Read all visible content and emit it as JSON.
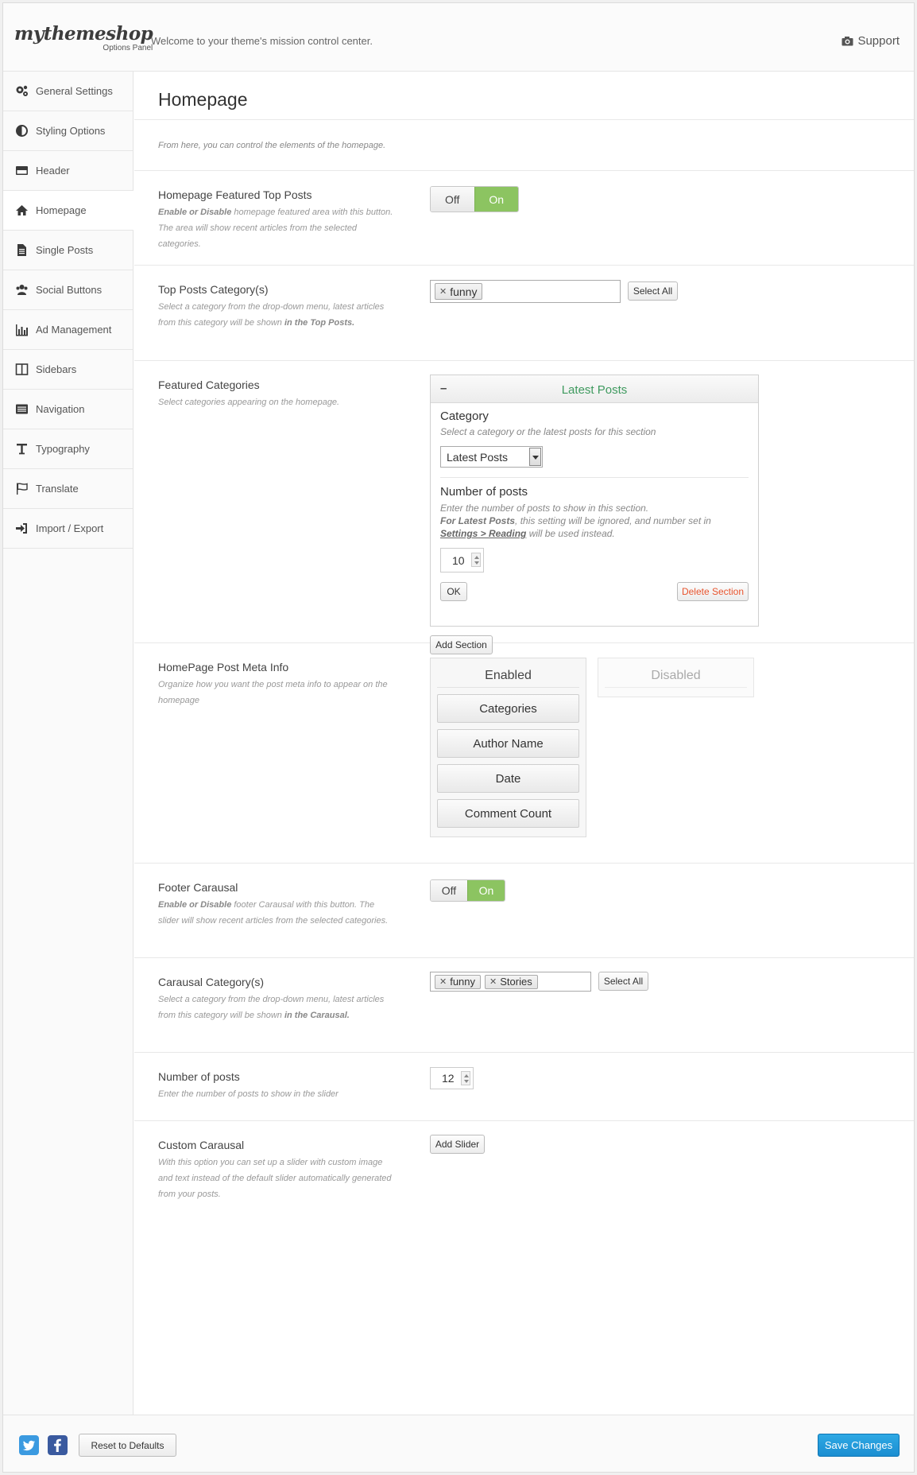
{
  "header": {
    "logo_main": "mythemeshop",
    "logo_sub": "Options Panel",
    "welcome": "Welcome to your theme's mission control center.",
    "support_label": "Support",
    "support_icon": "support-camera-icon"
  },
  "sidebar": {
    "items": [
      {
        "label": "General Settings",
        "icon": "gears-icon"
      },
      {
        "label": "Styling Options",
        "icon": "contrast-icon"
      },
      {
        "label": "Header",
        "icon": "credit-card-icon"
      },
      {
        "label": "Homepage",
        "icon": "home-icon",
        "active": true
      },
      {
        "label": "Single Posts",
        "icon": "document-icon"
      },
      {
        "label": "Social Buttons",
        "icon": "users-icon"
      },
      {
        "label": "Ad Management",
        "icon": "bar-chart-icon"
      },
      {
        "label": "Sidebars",
        "icon": "columns-icon"
      },
      {
        "label": "Navigation",
        "icon": "list-icon"
      },
      {
        "label": "Typography",
        "icon": "text-icon"
      },
      {
        "label": "Translate",
        "icon": "flag-icon"
      },
      {
        "label": "Import / Export",
        "icon": "import-icon"
      }
    ]
  },
  "main": {
    "title": "Homepage",
    "intro": "From here, you can control the elements of the homepage.",
    "featured_top": {
      "title": "Homepage Featured Top Posts",
      "desc_bold": "Enable or Disable",
      "desc_rest": " homepage featured area with this button. The area will show recent articles from the selected categories.",
      "off_label": "Off",
      "on_label": "On",
      "value": "On"
    },
    "top_category": {
      "title": "Top Posts Category(s)",
      "desc_start": "Select a category from the drop-down menu, latest articles from this category will be shown ",
      "desc_bold": "in the Top Posts.",
      "tags": [
        "funny"
      ],
      "select_all": "Select All"
    },
    "featured_categories": {
      "title": "Featured Categories",
      "desc": "Select categories appearing on the homepage.",
      "panel_title": "Latest Posts",
      "collapse_symbol": "–",
      "category_label": "Category",
      "category_desc": "Select a category or the latest posts for this section",
      "category_value": "Latest Posts",
      "posts_label": "Number of posts",
      "posts_desc_1": "Enter the number of posts to show in this section.",
      "posts_desc_bold": "For Latest Posts",
      "posts_desc_2": ", this setting will be ignored, and number set in ",
      "posts_desc_link": "Settings > Reading",
      "posts_desc_3": " will be used instead.",
      "posts_value": "10",
      "ok_label": "OK",
      "delete_label": "Delete Section",
      "add_section": "Add Section"
    },
    "post_meta": {
      "title": "HomePage Post Meta Info",
      "desc": "Organize how you want the post meta info to appear on the homepage",
      "enabled_label": "Enabled",
      "disabled_label": "Disabled",
      "enabled_items": [
        "Categories",
        "Author Name",
        "Date",
        "Comment Count"
      ]
    },
    "footer_carousel": {
      "title": "Footer Carausal",
      "desc_bold": "Enable or Disable",
      "desc_rest": " footer Carausal with this button. The slider will show recent articles from the selected categories.",
      "off_label": "Off",
      "on_label": "On",
      "value": "On"
    },
    "carousel_category": {
      "title": "Carausal Category(s)",
      "desc_start": "Select a category from the drop-down menu, latest articles from this category will be shown ",
      "desc_bold": "in the Carausal.",
      "tags": [
        "funny",
        "Stories"
      ],
      "select_all": "Select All"
    },
    "number_posts": {
      "title": "Number of posts",
      "desc": "Enter the number of posts to show in the slider",
      "value": "12"
    },
    "custom_carousel": {
      "title": "Custom Carausal",
      "desc": "With this option you can set up a slider with custom image and text instead of the default slider automatically generated from your posts.",
      "add_slider": "Add Slider"
    }
  },
  "footer": {
    "reset_label": "Reset to Defaults",
    "save_label": "Save Changes",
    "twitter_icon": "twitter-icon",
    "facebook_icon": "facebook-icon"
  },
  "colors": {
    "toggle_on": "#8cc461",
    "panel_title": "#3f9a5f",
    "delete": "#e8542e",
    "save": "#1b8ed1"
  }
}
